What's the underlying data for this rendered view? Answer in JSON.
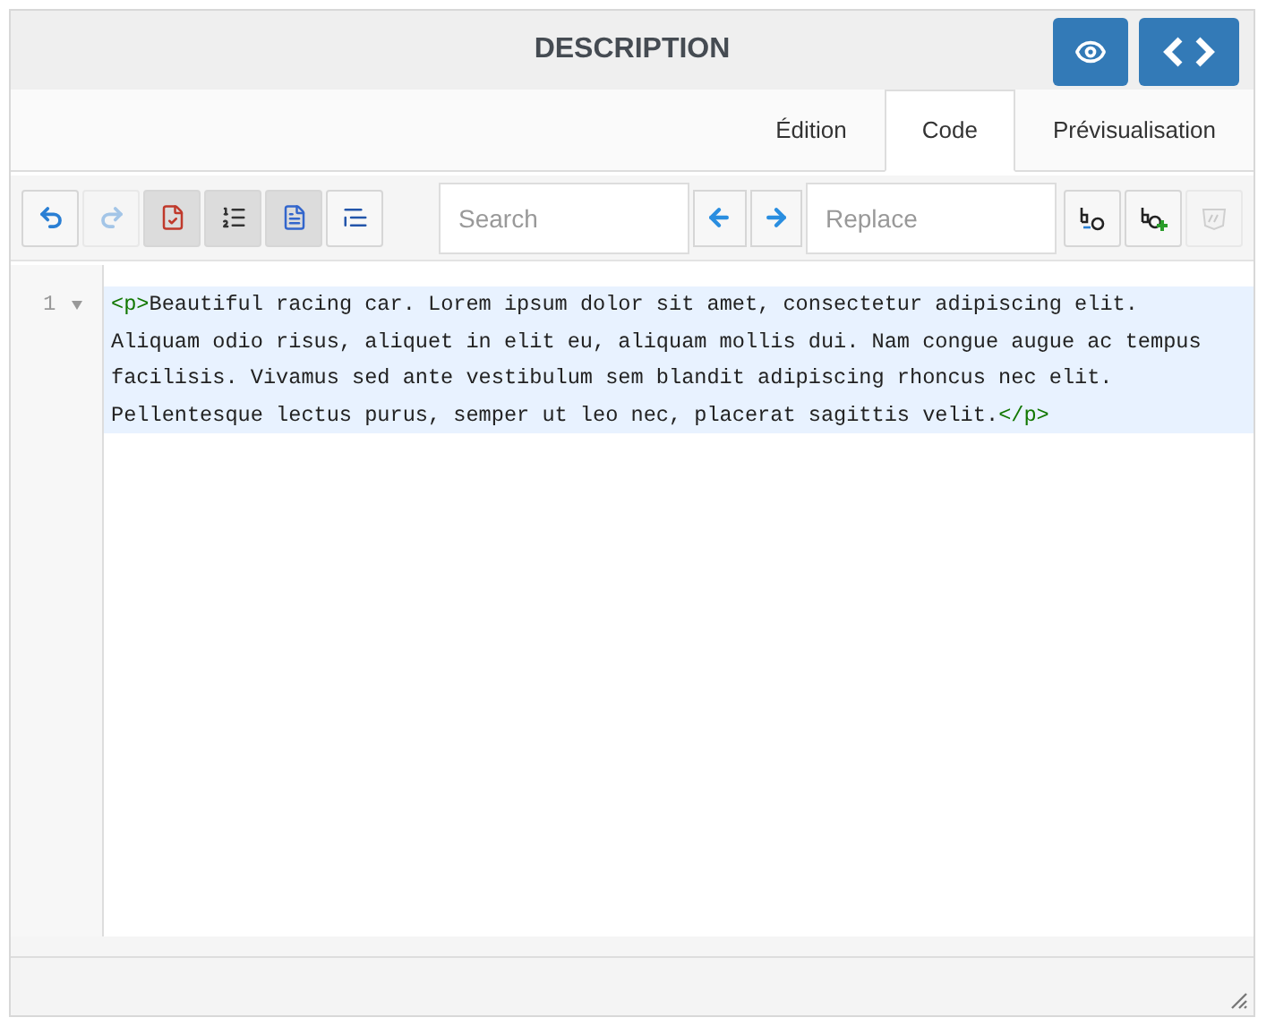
{
  "header": {
    "title": "DESCRIPTION"
  },
  "tabs": [
    {
      "label": "Édition",
      "selected": false
    },
    {
      "label": "Code",
      "selected": true
    },
    {
      "label": "Prévisualisation",
      "selected": false
    }
  ],
  "toolbar": {
    "left_buttons": [
      {
        "kind": "undo",
        "pressed": false,
        "disabled": false
      },
      {
        "kind": "redo",
        "pressed": false,
        "disabled": true
      },
      {
        "kind": "spellcheck",
        "pressed": true,
        "disabled": false
      },
      {
        "kind": "numbered-list",
        "pressed": true,
        "disabled": false
      },
      {
        "kind": "document",
        "pressed": true,
        "disabled": false
      },
      {
        "kind": "indent",
        "pressed": false,
        "disabled": false
      }
    ],
    "search": {
      "placeholder": "Search"
    },
    "replace": {
      "placeholder": "Replace"
    },
    "right_buttons": [
      {
        "kind": "replace-one",
        "pressed": false,
        "disabled": false
      },
      {
        "kind": "replace-all",
        "pressed": false,
        "disabled": false
      },
      {
        "kind": "clear",
        "pressed": false,
        "disabled": true
      }
    ]
  },
  "editor": {
    "lines": [
      {
        "number": "1",
        "open_tag": "<p>",
        "text": "Beautiful racing car. Lorem ipsum dolor sit amet, consectetur adipiscing elit. Aliquam odio risus, aliquet in elit eu, aliquam mollis dui. Nam congue augue ac tempus facilisis. Vivamus sed ante vestibulum sem blandit adipiscing rhoncus nec elit. Pellentesque lectus purus, semper ut leo nec, placerat sagittis velit.",
        "close_tag": "</p>"
      }
    ]
  }
}
